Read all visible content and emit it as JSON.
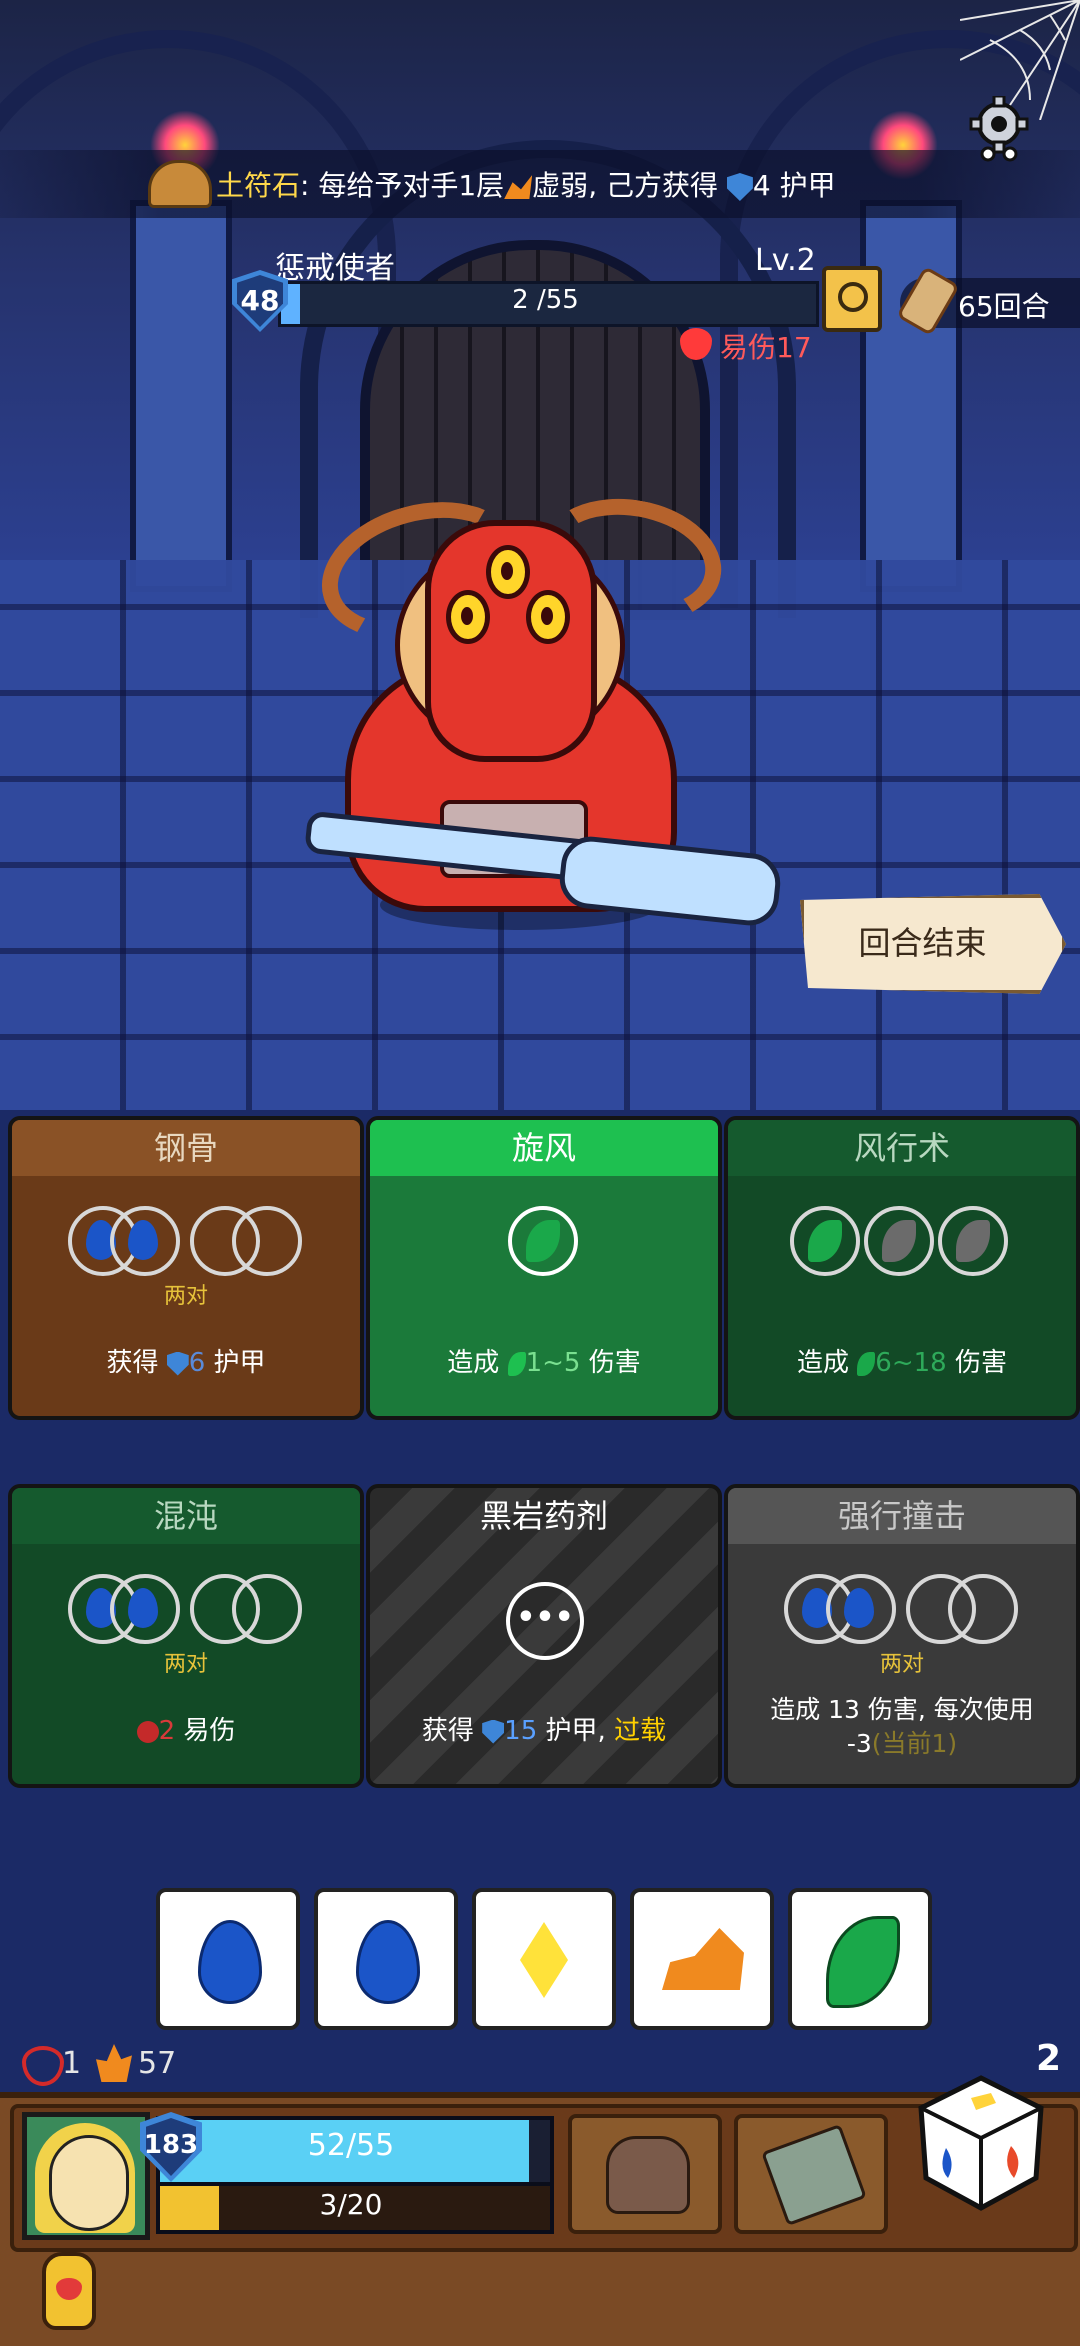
{
  "relic": {
    "name": "土符石",
    "colon": ":",
    "text_a": " 每给予对手1层",
    "debuff": "虚弱",
    "text_b": ", 己方获得 ",
    "armor_value": "4",
    "armor_label": " 护甲"
  },
  "enemy": {
    "name": "惩戒使者",
    "level": "Lv.2",
    "shield": "48",
    "hp_text": "2 /55",
    "hp_fraction": 0.036,
    "status": "易伤17"
  },
  "turns": "65回合",
  "end_turn_label": "回合结束",
  "cards": [
    {
      "title": "钢骨",
      "sub": "两对",
      "desc_a": "获得 ",
      "desc_val": "6",
      "desc_b": " 护甲"
    },
    {
      "title": "旋风",
      "desc_a": "造成 ",
      "desc_val": "1~5",
      "desc_b": " 伤害"
    },
    {
      "title": "风行术",
      "desc_a": "造成 ",
      "desc_val": "6~18",
      "desc_b": " 伤害"
    },
    {
      "title": "混沌",
      "sub": "两对",
      "desc_val": "2",
      "desc_b": " 易伤"
    },
    {
      "title": "黑岩药剂",
      "ellipsis": "•••",
      "desc_a": "获得 ",
      "desc_val": "15",
      "desc_b": " 护甲, ",
      "desc_hi": "过载"
    },
    {
      "title": "强行撞击",
      "sub": "两对",
      "desc_line1": "造成 13 伤害, 每次使用",
      "desc_line2": "-3",
      "desc_note": "(当前1)"
    }
  ],
  "dice": [
    "water",
    "water",
    "light",
    "earth",
    "wind"
  ],
  "player": {
    "hearts": "1",
    "flames": "57",
    "shield": "183",
    "hp_text": "52/55",
    "hp_fraction": 0.945,
    "xp_text": "3/20",
    "xp_fraction": 0.15,
    "dice_count": "2"
  },
  "colors": {
    "enemy_hp": "#5fb2ff",
    "player_hp": "#5ad0f5",
    "xp": "#f2c230",
    "highlight": "#ffd000",
    "vulnerable": "#ff5a5a"
  }
}
